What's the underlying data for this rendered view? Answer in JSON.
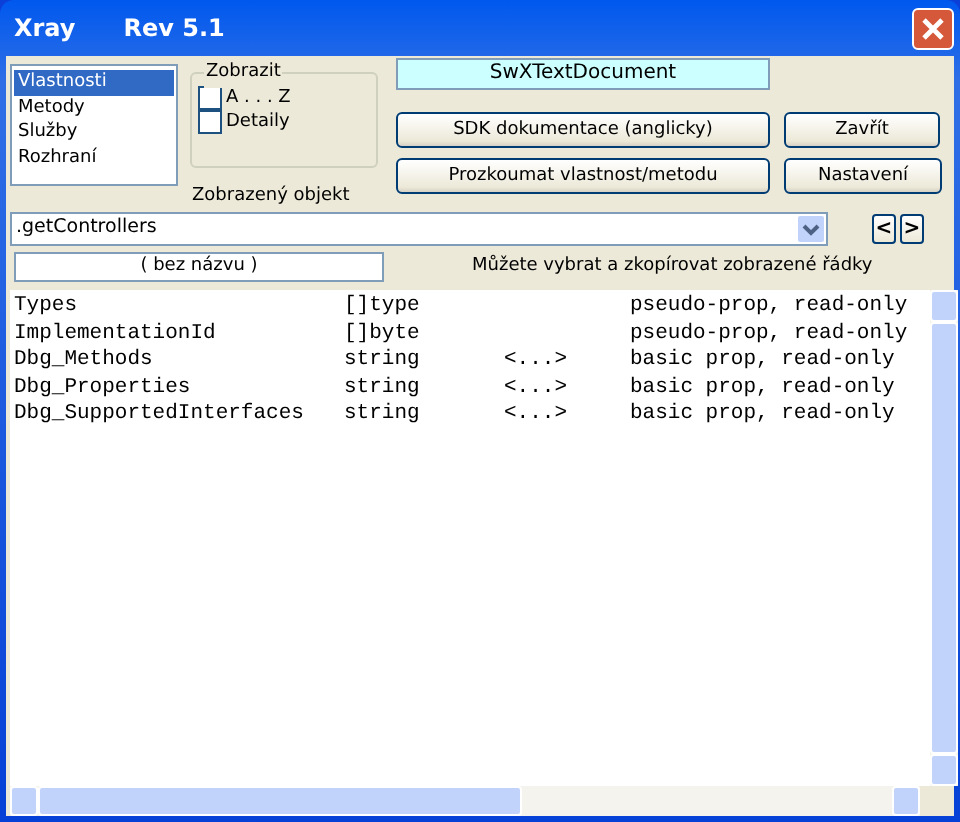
{
  "window": {
    "title": "Xray",
    "version": "Rev 5.1"
  },
  "views": [
    {
      "label": "Vlastnosti",
      "selected": true
    },
    {
      "label": "Metody",
      "selected": false
    },
    {
      "label": "Služby",
      "selected": false
    },
    {
      "label": "Rozhraní",
      "selected": false
    }
  ],
  "display_group": {
    "title": "Zobrazit",
    "options": [
      {
        "label": "A . . . Z",
        "checked": false
      },
      {
        "label": "Detaily",
        "checked": false
      }
    ]
  },
  "object_type": "SwXTextDocument",
  "sdk_button": "SDK dokumentace (anglicky)",
  "close_button": "Zavřít",
  "inspect_button": "Prozkoumat vlastnost/metodu",
  "settings_button": "Nastavení",
  "displayed_object": {
    "label": "Zobrazený objekt",
    "value": ".getControllers"
  },
  "nav_buttons": [
    "<",
    ">"
  ],
  "name_field": "( bez názvu )",
  "hint": "Můžete vybrat a zkopírovat zobrazené řádky",
  "rows": [
    {
      "name": "Types",
      "type": "[]type",
      "value": "",
      "info": "pseudo-prop, read-only"
    },
    {
      "name": "ImplementationId",
      "type": "[]byte",
      "value": "",
      "info": "pseudo-prop, read-only"
    },
    {
      "name": "Dbg_Methods",
      "type": "string",
      "value": "<...>",
      "info": "basic prop, read-only"
    },
    {
      "name": "Dbg_Properties",
      "type": "string",
      "value": "<...>",
      "info": "basic prop, read-only"
    },
    {
      "name": "Dbg_SupportedInterfaces",
      "type": "string",
      "value": "<...>",
      "info": "basic prop, read-only"
    }
  ]
}
